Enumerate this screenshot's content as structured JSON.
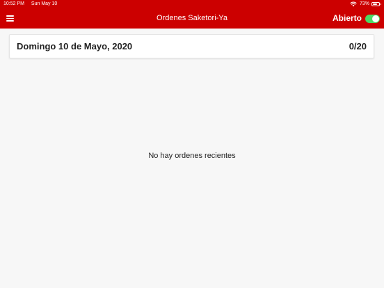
{
  "status_bar": {
    "time": "10:52 PM",
    "date": "Sun May 10",
    "battery_percent": "73%",
    "battery_level": 0.73,
    "icons": [
      "wifi-icon",
      "battery-icon"
    ]
  },
  "nav": {
    "title": "Ordenes Saketori-Ya",
    "menu_icon": "hamburger-menu-icon",
    "open_label": "Abierto",
    "open_toggle_on": true
  },
  "day_summary": {
    "date": "Domingo 10 de Mayo, 2020",
    "order_count": "0/20"
  },
  "orders": {
    "empty_message": "No hay ordenes recientes"
  },
  "colors": {
    "header": "#cc0000",
    "background": "#f7f7f7",
    "toggle_on": "#4cd964"
  }
}
